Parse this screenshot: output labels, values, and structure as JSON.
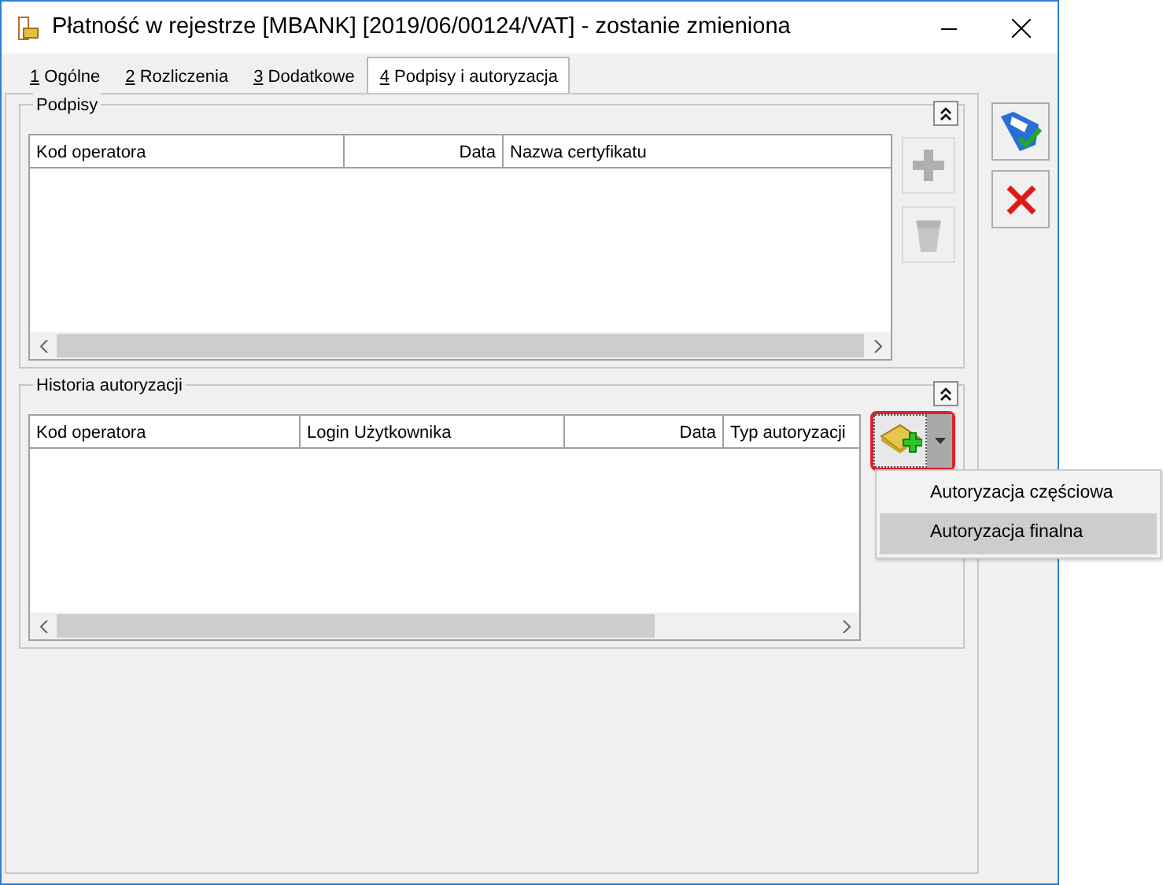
{
  "window": {
    "title": "Płatność w rejestrze [MBANK] [2019/06/00124/VAT] - zostanie zmieniona"
  },
  "tabs": [
    {
      "key": "1",
      "label": "Ogólne",
      "selected": false
    },
    {
      "key": "2",
      "label": "Rozliczenia",
      "selected": false
    },
    {
      "key": "3",
      "label": "Dodatkowe",
      "selected": false
    },
    {
      "key": "4",
      "label": "Podpisy i autoryzacja",
      "selected": true
    }
  ],
  "signatures": {
    "title": "Podpisy",
    "columns": [
      {
        "label": "Kod operatora",
        "kind": "text"
      },
      {
        "label": "Data",
        "kind": "date"
      },
      {
        "label": "Nazwa certyfikatu",
        "kind": "text"
      }
    ],
    "buttons": [
      {
        "kind": "add",
        "disabled": true
      },
      {
        "kind": "delete",
        "disabled": true
      }
    ]
  },
  "history": {
    "title": "Historia autoryzacji",
    "columns": [
      {
        "label": "Kod operatora",
        "kind": "text"
      },
      {
        "label": "Login Użytkownika",
        "kind": "text"
      },
      {
        "label": "Data",
        "kind": "date"
      },
      {
        "label": "Typ autoryzacji",
        "kind": "text"
      }
    ],
    "menu": [
      {
        "label": "Autoryzacja częściowa",
        "selected": false
      },
      {
        "label": "Autoryzacja finalna",
        "selected": true
      }
    ]
  }
}
